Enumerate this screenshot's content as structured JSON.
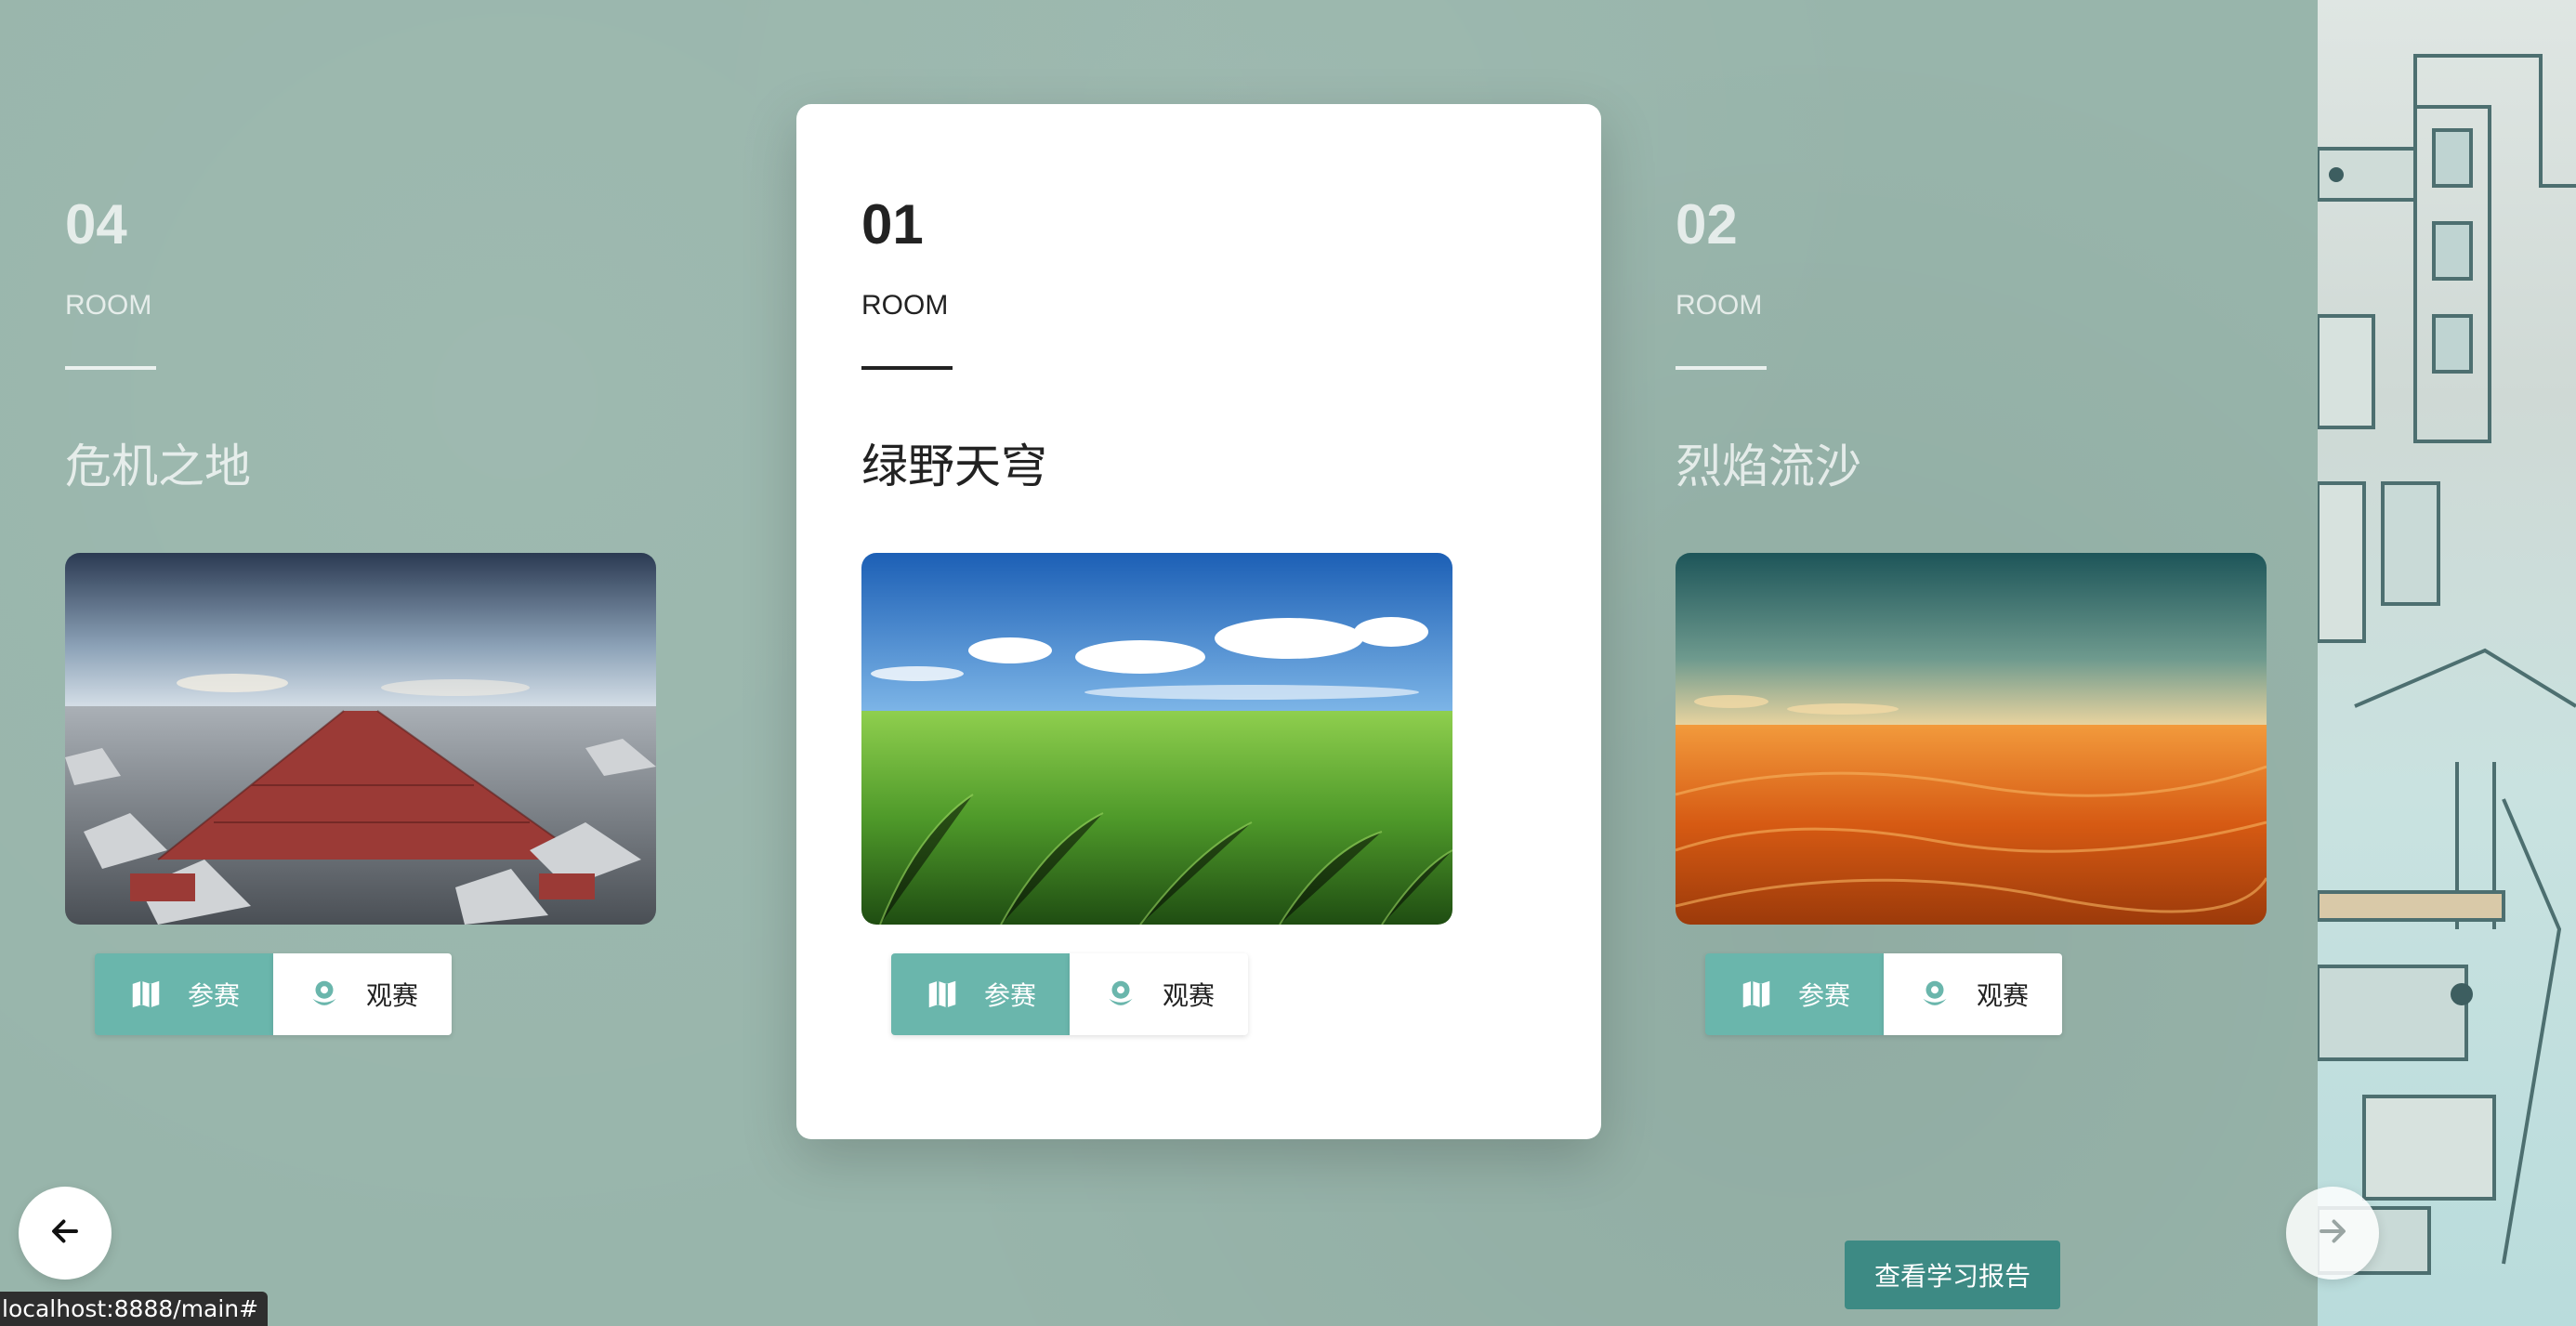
{
  "cards": [
    {
      "number": "04",
      "room_label": "ROOM",
      "title": "危机之地",
      "join_label": "参赛",
      "watch_label": "观赛",
      "image": "rocky-wasteland-with-red-blocks"
    },
    {
      "number": "01",
      "room_label": "ROOM",
      "title": "绿野天穹",
      "join_label": "参赛",
      "watch_label": "观赛",
      "image": "green-grassland-under-blue-sky"
    },
    {
      "number": "02",
      "room_label": "ROOM",
      "title": "烈焰流沙",
      "join_label": "参赛",
      "watch_label": "观赛",
      "image": "orange-desert-dunes"
    }
  ],
  "report_button": "查看学习报告",
  "status_url": "localhost:8888/main#",
  "icons": {
    "join": "map-icon",
    "watch": "flower-icon",
    "prev": "arrow-left-icon",
    "next": "arrow-right-icon"
  },
  "colors": {
    "background": "#98b5ab",
    "accent": "#6ab6ac",
    "report_button": "#3d8a84"
  }
}
